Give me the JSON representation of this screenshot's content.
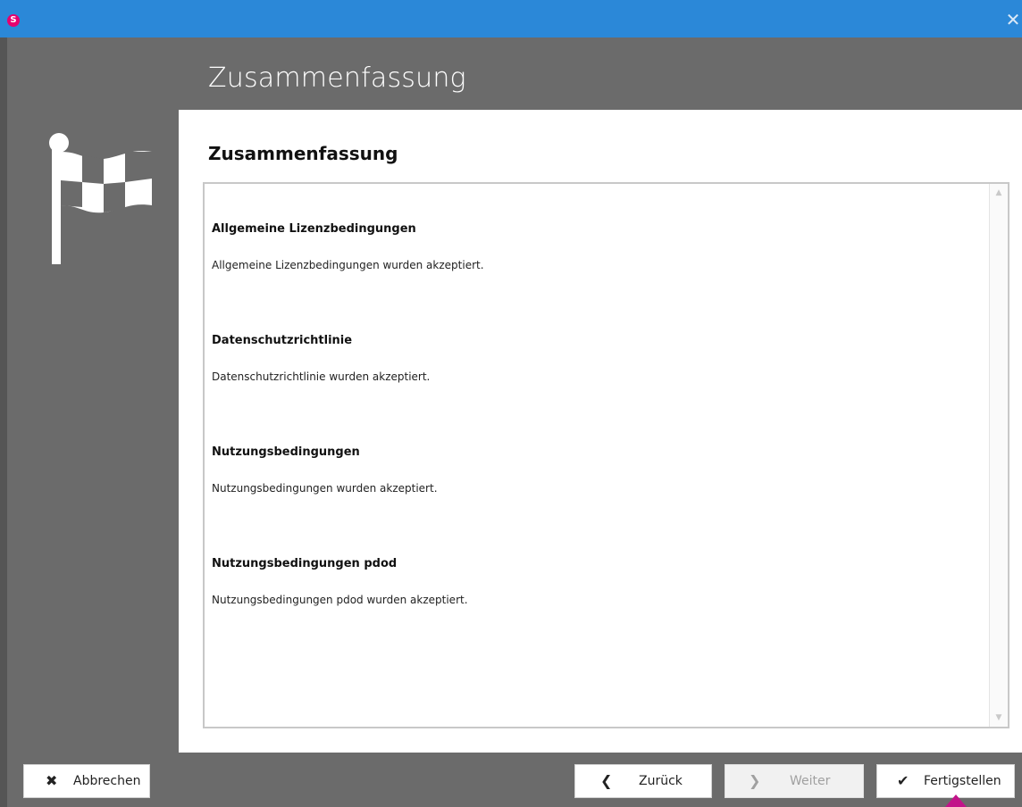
{
  "window": {
    "logo_letter": "S",
    "close_glyph": "✕",
    "accent_color": "#2b88d8",
    "logo_color": "#e6006e"
  },
  "header": {
    "title": "Zusammenfassung",
    "icon": "checkered-flag-icon"
  },
  "main": {
    "section_title": "Zusammenfassung",
    "entries": [
      {
        "heading": "Allgemeine Lizenzbedingungen",
        "text": "Allgemeine Lizenzbedingungen wurden akzeptiert."
      },
      {
        "heading": "Datenschutzrichtlinie",
        "text": "Datenschutzrichtlinie wurden akzeptiert."
      },
      {
        "heading": "Nutzungsbedingungen",
        "text": "Nutzungsbedingungen wurden akzeptiert."
      },
      {
        "heading": "Nutzungsbedingungen pdod",
        "text": "Nutzungsbedingungen pdod wurden akzeptiert."
      }
    ]
  },
  "footer": {
    "cancel_label": "Abbrechen",
    "cancel_icon": "✖",
    "back_label": "Zurück",
    "back_icon": "❮",
    "next_label": "Weiter",
    "next_icon": "❯",
    "next_enabled": false,
    "finish_label": "Fertigstellen",
    "finish_icon": "✔"
  }
}
